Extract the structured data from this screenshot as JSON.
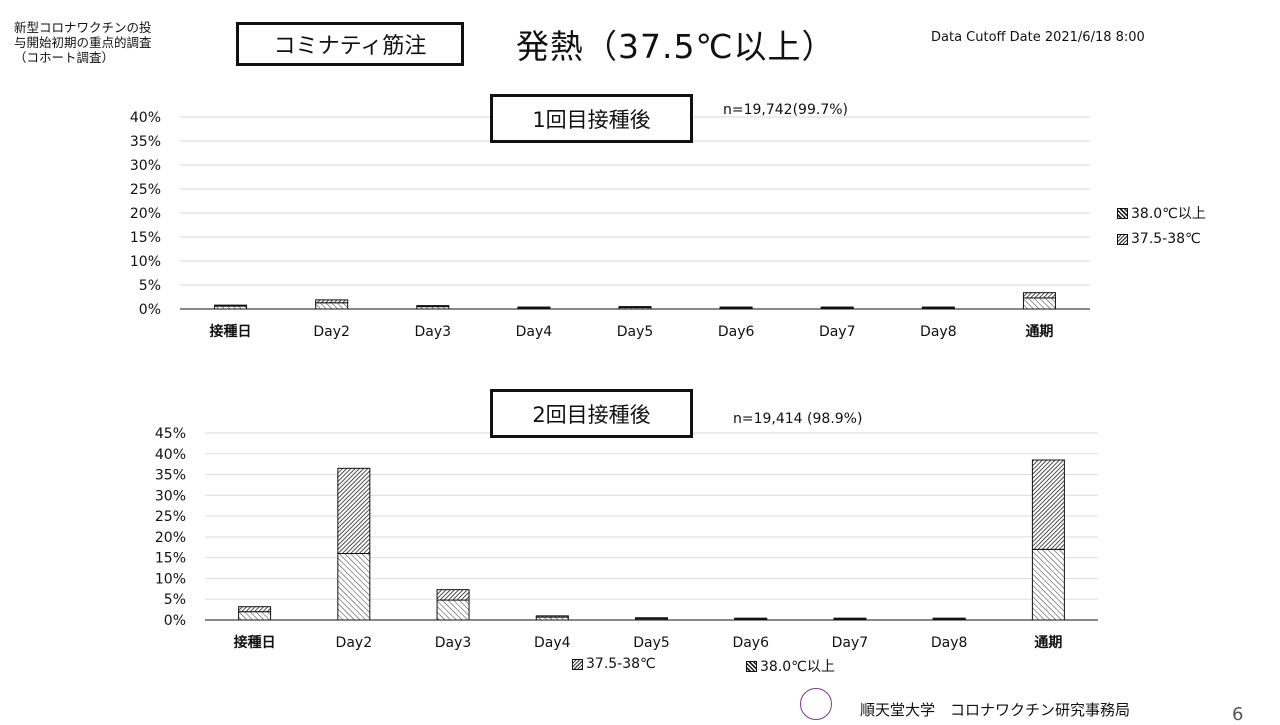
{
  "header": {
    "study_label": "新型コロナワクチンの投\n与開始初期の重点的調査\n（コホート調査）",
    "vaccine": "コミナティ筋注",
    "title": "発熱（37.5℃以上）",
    "cutoff": "Data Cutoff Date 2021/6/18 8:00"
  },
  "footer": {
    "institution": "順天堂大学　コロナワクチン研究事務局",
    "page_number": "6"
  },
  "colors": {
    "axis": "#111111",
    "grid": "#d9d9d9"
  },
  "chart_data": [
    {
      "type": "bar",
      "stacked": true,
      "title": "1回目接種後",
      "n_label": "n=19,742(99.7%)",
      "categories": [
        "接種日",
        "Day2",
        "Day3",
        "Day4",
        "Day5",
        "Day6",
        "Day7",
        "Day8",
        "通期"
      ],
      "series": [
        {
          "name": "37.5-38℃",
          "pattern": "low",
          "values": [
            0.6,
            1.3,
            0.5,
            0.2,
            0.3,
            0.2,
            0.2,
            0.2,
            2.3
          ]
        },
        {
          "name": "38.0℃以上",
          "pattern": "high",
          "values": [
            0.1,
            0.6,
            0.1,
            0.05,
            0.05,
            0.05,
            0.05,
            0.05,
            1.1
          ]
        }
      ],
      "yticks": [
        0,
        5,
        10,
        15,
        20,
        25,
        30,
        35,
        40
      ],
      "ytick_labels": [
        "0%",
        "5%",
        "10%",
        "15%",
        "20%",
        "25%",
        "30%",
        "35%",
        "40%"
      ],
      "ylim": [
        0,
        40
      ],
      "grid": true,
      "legend": "right"
    },
    {
      "type": "bar",
      "stacked": true,
      "title": "2回目接種後",
      "n_label": "n=19,414 (98.9%)",
      "categories": [
        "接種日",
        "Day2",
        "Day3",
        "Day4",
        "Day5",
        "Day6",
        "Day7",
        "Day8",
        "通期"
      ],
      "series": [
        {
          "name": "37.5-38℃",
          "pattern": "low",
          "values": [
            2.0,
            16.0,
            4.8,
            0.7,
            0.3,
            0.2,
            0.2,
            0.2,
            17.0
          ]
        },
        {
          "name": "38.0℃以上",
          "pattern": "high",
          "values": [
            1.2,
            20.5,
            2.5,
            0.3,
            0.1,
            0.1,
            0.1,
            0.1,
            21.5
          ]
        }
      ],
      "yticks": [
        0,
        5,
        10,
        15,
        20,
        25,
        30,
        35,
        40,
        45
      ],
      "ytick_labels": [
        "0%",
        "5%",
        "10%",
        "15%",
        "20%",
        "25%",
        "30%",
        "35%",
        "40%",
        "45%"
      ],
      "ylim": [
        0,
        45
      ],
      "grid": true,
      "legend": "bottom"
    }
  ]
}
